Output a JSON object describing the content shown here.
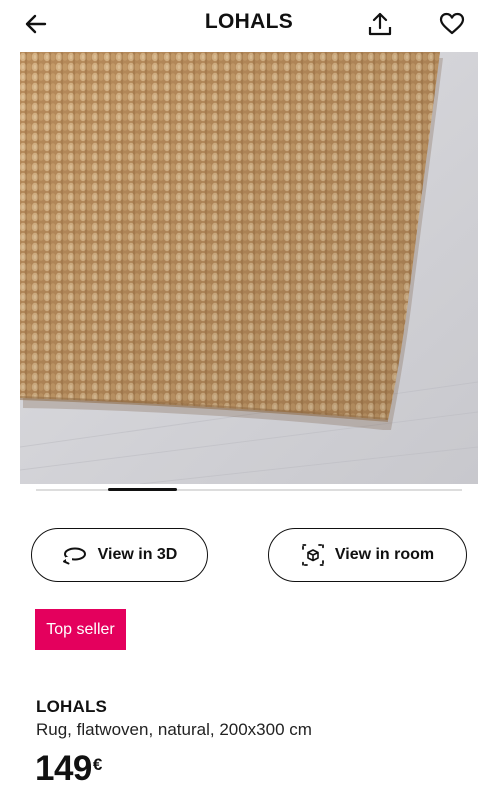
{
  "header": {
    "title": "LOHALS",
    "back_icon": "arrow-left-icon",
    "share_icon": "share-icon",
    "favorite_icon": "heart-icon"
  },
  "carousel": {
    "active_fraction_start": 0.17,
    "active_fraction_width": 0.16
  },
  "actions": {
    "view_3d_label": "View in 3D",
    "view_3d_icon": "rotate-3d-icon",
    "view_room_label": "View in room",
    "view_room_icon": "ar-cube-icon"
  },
  "badge": {
    "label": "Top seller",
    "color": "#e4005d"
  },
  "product": {
    "name": "LOHALS",
    "description": "Rug, flatwoven, natural, 200x300 cm",
    "price": "149",
    "currency": "€"
  }
}
